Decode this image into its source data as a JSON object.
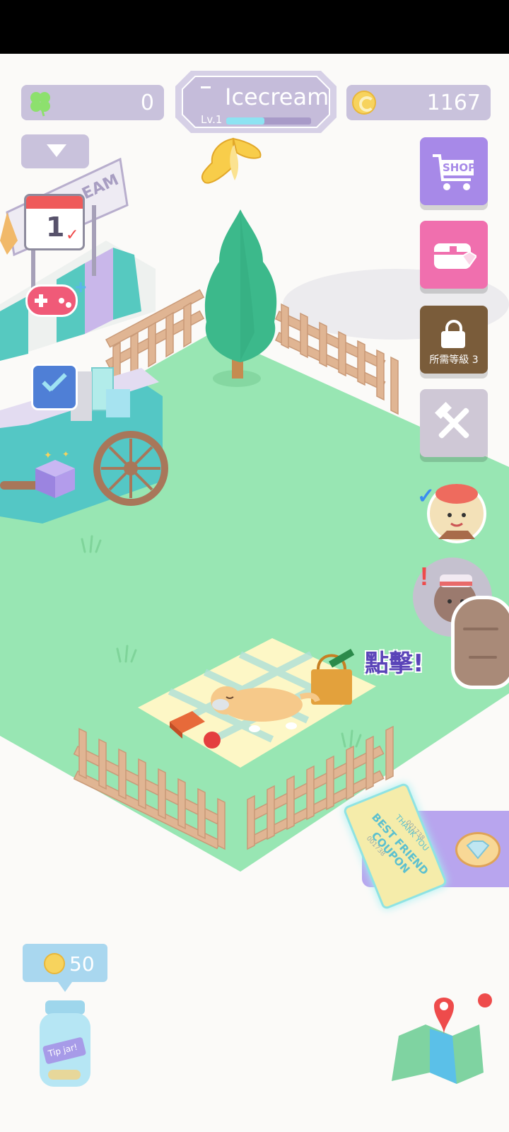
{
  "hud": {
    "clover_count": "0",
    "title": "Icecream",
    "level": "Lv.1",
    "level_progress": 0.45,
    "coins": "1167"
  },
  "side_menu": {
    "shop_label": "SHOP",
    "locked_label": "所需等級 3"
  },
  "scene": {
    "tap_hint": "點擊!",
    "stand_sign": "EAM",
    "calendar_day": "1",
    "coupon_text": "BEST FRIEND COUPON",
    "coupon_side_text": "THANK YOU",
    "coupon_number_top": "001738",
    "coupon_number_bottom": "001738",
    "tip_jar_label": "Tip jar!"
  },
  "tip": {
    "amount": "50"
  },
  "icons": [
    "clover-icon",
    "coin-icon",
    "chevron-down-icon",
    "calendar-icon",
    "gamepad-icon",
    "checklist-icon",
    "mystery-box-icon",
    "cart-icon",
    "chest-icon",
    "lock-icon",
    "tools-icon",
    "map-icon",
    "diamond-icon"
  ],
  "colors": {
    "grass": "#98e6b3",
    "hud_purple": "#c9c2dc",
    "shop_purple": "#a789e8",
    "chest_pink": "#f06fae",
    "locked_brown": "#7a5c3a",
    "tools_grey": "#cfc8d6",
    "notification_red": "#ee4b4b",
    "tip_bubble": "#a9d7ef"
  }
}
